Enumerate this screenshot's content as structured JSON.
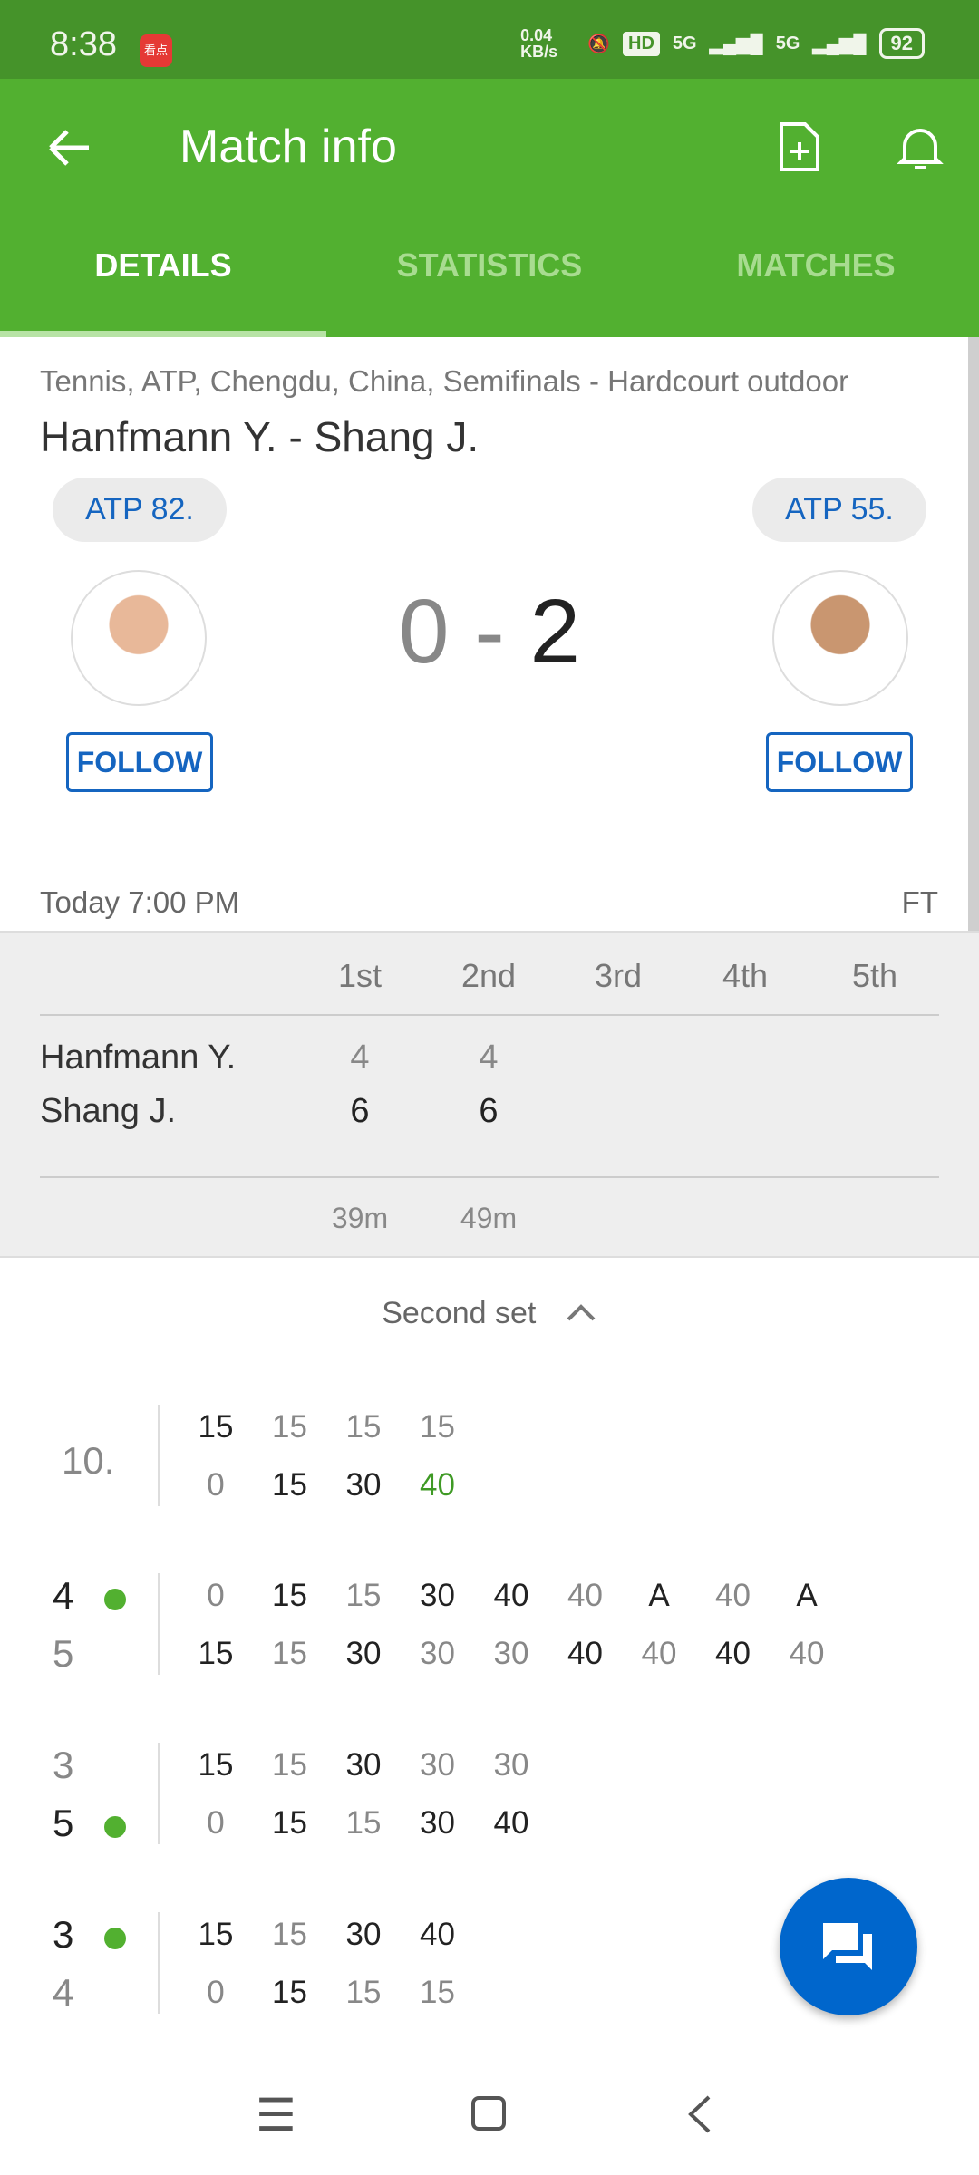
{
  "status": {
    "time": "8:38",
    "app_badge": "看点",
    "net": "0.04 KB/s",
    "hd": "HD",
    "signal1": "5G",
    "signal2": "5G",
    "battery": "92"
  },
  "header": {
    "title": "Match info",
    "tabs": [
      "DETAILS",
      "STATISTICS",
      "MATCHES"
    ],
    "active_tab": 0
  },
  "match": {
    "breadcrumb": "Tennis, ATP, Chengdu, China, Semifinals - Hardcourt outdoor",
    "title": "Hanfmann Y. - Shang J.",
    "home": {
      "rank": "ATP 82.",
      "follow": "FOLLOW"
    },
    "away": {
      "rank": "ATP 55.",
      "follow": "FOLLOW"
    },
    "score_home": "0",
    "score_sep": "-",
    "score_away": "2",
    "date": "Today 7:00 PM",
    "status": "FT"
  },
  "sets_table": {
    "headers": [
      "1st",
      "2nd",
      "3rd",
      "4th",
      "5th"
    ],
    "rows": [
      {
        "name": "Hanfmann Y.",
        "scores": [
          "4",
          "4"
        ]
      },
      {
        "name": "Shang J.",
        "scores": [
          "6",
          "6"
        ]
      }
    ],
    "durations": [
      "39m",
      "49m"
    ]
  },
  "point_by_point": {
    "set_label": "Second set",
    "games": [
      {
        "top_label": "10.",
        "bottom_label": "",
        "server": null,
        "label_winner": null,
        "top": [
          "15",
          "15",
          "15",
          "15"
        ],
        "bottom": [
          "0",
          "15",
          "30",
          "40"
        ],
        "winner": [
          0,
          1,
          1,
          1
        ],
        "green_bottom": [
          3
        ]
      },
      {
        "top_label": "4",
        "bottom_label": "5",
        "server": 0,
        "label_winner": 0,
        "top": [
          "0",
          "15",
          "15",
          "30",
          "40",
          "40",
          "A",
          "40",
          "A"
        ],
        "bottom": [
          "15",
          "15",
          "30",
          "30",
          "30",
          "40",
          "40",
          "40",
          "40"
        ],
        "winner": [
          1,
          0,
          1,
          0,
          0,
          1,
          0,
          1,
          0
        ]
      },
      {
        "top_label": "3",
        "bottom_label": "5",
        "server": 1,
        "label_winner": 1,
        "top": [
          "15",
          "15",
          "30",
          "30",
          "30"
        ],
        "bottom": [
          "0",
          "15",
          "15",
          "30",
          "40"
        ],
        "winner": [
          0,
          1,
          0,
          1,
          1
        ]
      },
      {
        "top_label": "3",
        "bottom_label": "4",
        "server": 0,
        "label_winner": 0,
        "top": [
          "15",
          "15",
          "30",
          "40"
        ],
        "bottom": [
          "0",
          "15",
          "15",
          "15"
        ],
        "winner": [
          0,
          1,
          0,
          0
        ]
      }
    ]
  },
  "colors": {
    "status_bar": "#45932a",
    "app_bar": "#52b030",
    "accent_blue": "#1565c0",
    "fab": "#0066cc"
  }
}
